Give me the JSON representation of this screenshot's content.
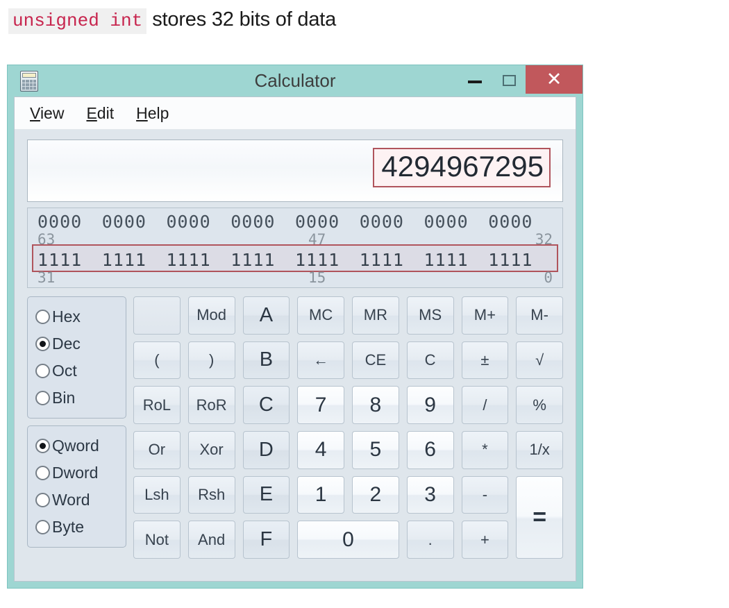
{
  "caption": {
    "code": "unsigned int",
    "text": "stores 32 bits of data"
  },
  "window": {
    "title": "Calculator",
    "icon": "calculator-icon",
    "controls": {
      "minimize": "–",
      "maximize": "□",
      "close": "✕"
    },
    "colors": {
      "titlebar": "#9ed6d2",
      "close_button": "#c1585c",
      "annotation": "#b0545c",
      "client": "#dfe6ec"
    }
  },
  "menu": [
    {
      "mnemonic": "V",
      "rest": "iew"
    },
    {
      "mnemonic": "E",
      "rest": "dit"
    },
    {
      "mnemonic": "H",
      "rest": "elp"
    }
  ],
  "display": {
    "value": "4294967295"
  },
  "bits": {
    "top_groups": [
      "0000",
      "0000",
      "0000",
      "0000",
      "0000",
      "0000",
      "0000",
      "0000"
    ],
    "bottom_groups": [
      "1111",
      "1111",
      "1111",
      "1111",
      "1111",
      "1111",
      "1111",
      "1111"
    ],
    "top_labels": {
      "left": "63",
      "middle": "47",
      "right": "32"
    },
    "bottom_labels": {
      "left": "31",
      "middle": "15",
      "right": "0"
    }
  },
  "base_group": {
    "options": [
      "Hex",
      "Dec",
      "Oct",
      "Bin"
    ],
    "selected": "Dec"
  },
  "word_group": {
    "options": [
      "Qword",
      "Dword",
      "Word",
      "Byte"
    ],
    "selected": "Qword"
  },
  "keys": [
    {
      "label": "",
      "style": "blank"
    },
    {
      "label": "Mod",
      "style": "fn"
    },
    {
      "label": "A",
      "style": "hexl"
    },
    {
      "label": "MC",
      "style": "fn"
    },
    {
      "label": "MR",
      "style": "fn"
    },
    {
      "label": "MS",
      "style": "fn"
    },
    {
      "label": "M+",
      "style": "fn"
    },
    {
      "label": "M-",
      "style": "fn"
    },
    {
      "label": "(",
      "style": "fn"
    },
    {
      "label": ")",
      "style": "fn"
    },
    {
      "label": "B",
      "style": "hexl"
    },
    {
      "label": "←",
      "style": "fn arrow"
    },
    {
      "label": "CE",
      "style": "fn"
    },
    {
      "label": "C",
      "style": "fn"
    },
    {
      "label": "±",
      "style": "fn"
    },
    {
      "label": "√",
      "style": "fn"
    },
    {
      "label": "RoL",
      "style": "fn"
    },
    {
      "label": "RoR",
      "style": "fn"
    },
    {
      "label": "C",
      "style": "hexl"
    },
    {
      "label": "7",
      "style": "digit"
    },
    {
      "label": "8",
      "style": "digit"
    },
    {
      "label": "9",
      "style": "digit"
    },
    {
      "label": "/",
      "style": "fn"
    },
    {
      "label": "%",
      "style": "fn"
    },
    {
      "label": "Or",
      "style": "fn"
    },
    {
      "label": "Xor",
      "style": "fn"
    },
    {
      "label": "D",
      "style": "hexl"
    },
    {
      "label": "4",
      "style": "digit"
    },
    {
      "label": "5",
      "style": "digit"
    },
    {
      "label": "6",
      "style": "digit"
    },
    {
      "label": "*",
      "style": "fn"
    },
    {
      "label": "1/x",
      "style": "fn"
    },
    {
      "label": "Lsh",
      "style": "fn"
    },
    {
      "label": "Rsh",
      "style": "fn"
    },
    {
      "label": "E",
      "style": "hexl"
    },
    {
      "label": "1",
      "style": "digit"
    },
    {
      "label": "2",
      "style": "digit"
    },
    {
      "label": "3",
      "style": "digit"
    },
    {
      "label": "-",
      "style": "fn"
    },
    {
      "label": "=",
      "style": "eq"
    },
    {
      "label": "Not",
      "style": "fn"
    },
    {
      "label": "And",
      "style": "fn"
    },
    {
      "label": "F",
      "style": "hexl"
    },
    {
      "label": "0",
      "style": "digit wide0"
    },
    {
      "label": ".",
      "style": "fn"
    },
    {
      "label": "+",
      "style": "fn"
    }
  ]
}
